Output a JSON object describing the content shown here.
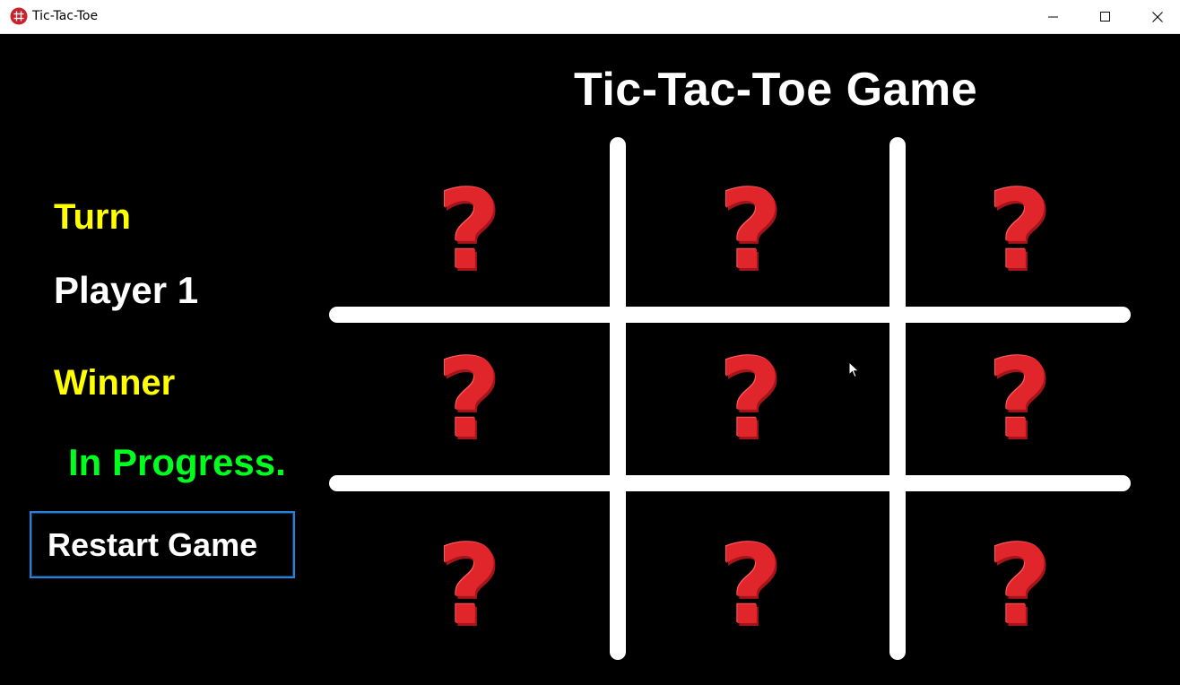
{
  "window": {
    "title": "Tic-Tac-Toe",
    "controls": [
      "minimize-icon",
      "maximize-icon",
      "close-icon"
    ]
  },
  "game": {
    "title": "Tic-Tac-Toe Game",
    "turn_label": "Turn",
    "current_player": "Player 1",
    "winner_label": "Winner",
    "status": "In Progress.",
    "restart_label": "Restart Game"
  },
  "board": {
    "cells": [
      "?",
      "?",
      "?",
      "?",
      "?",
      "?",
      "?",
      "?",
      "?"
    ],
    "cell_icon": "question-mark-icon"
  },
  "colors": {
    "background": "#000000",
    "title": "#ffffff",
    "labels": "#ffff00",
    "status": "#00ff1e",
    "question_mark": "#e0252b",
    "button_border": "#2a7fd6",
    "grid": "#ffffff"
  }
}
